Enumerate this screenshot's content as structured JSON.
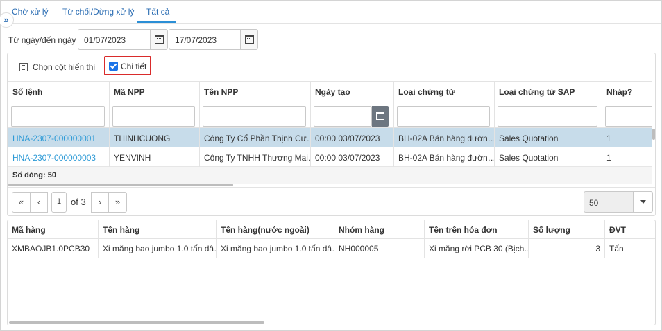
{
  "tabs": [
    {
      "label": "Chờ xử lý"
    },
    {
      "label": "Từ chối/Dừng xử lý"
    },
    {
      "label": "Tất cả"
    }
  ],
  "active_tab": "Tất cả",
  "date_filter": {
    "label": "Từ ngày/đến ngày",
    "from": "01/07/2023",
    "to": "17/07/2023"
  },
  "toolbar": {
    "choose_columns_label": "Chọn cột hiển thị",
    "detail_label": "Chi tiết",
    "detail_checked": true
  },
  "main_grid": {
    "columns": [
      "Số lệnh",
      "Mã NPP",
      "Tên NPP",
      "Ngày tạo",
      "Loại chứng từ",
      "Loại chứng từ SAP",
      "Nháp?"
    ],
    "rows": [
      [
        "HNA-2307-000000001",
        "THINHCUONG",
        "Công Ty Cổ Phần Thịnh Cư…",
        "00:00 03/07/2023",
        "BH-02A Bán hàng đườn…",
        "Sales Quotation",
        "1"
      ],
      [
        "HNA-2307-000000003",
        "YENVINH",
        "Công Ty TNHH Thương Mai…",
        "00:00 03/07/2023",
        "BH-02A Bán hàng đườn…",
        "Sales Quotation",
        "1"
      ]
    ],
    "summary": "Số dòng: 50"
  },
  "pager": {
    "page": "1",
    "of_label": "of 3",
    "page_size": "50"
  },
  "detail_grid": {
    "columns": [
      "Mã hàng",
      "Tên hàng",
      "Tên hàng(nước ngoài)",
      "Nhóm hàng",
      "Tên trên hóa đơn",
      "Số lượng",
      "ĐVT"
    ],
    "rows": [
      [
        "XMBAOJB1.0PCB30",
        "Xi măng bao jumbo 1.0 tấn dâ…",
        "Xi măng bao jumbo 1.0 tấn dâ…",
        "NH000005",
        "Xi măng rời PCB 30 (Bịch…",
        "3",
        "Tấn"
      ]
    ]
  },
  "colors": {
    "accent": "#2b8fd6",
    "link": "#2d9ad6",
    "selected_row": "#c7dcea",
    "highlight_border": "#d92b2b"
  }
}
